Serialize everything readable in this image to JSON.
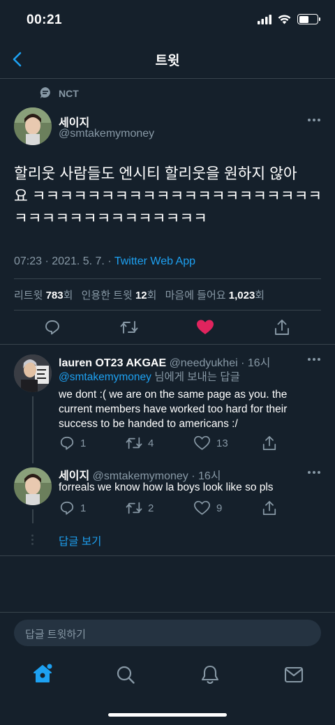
{
  "status_bar": {
    "time": "00:21"
  },
  "header": {
    "title": "트윗"
  },
  "social_context": {
    "label": "NCT"
  },
  "tweet": {
    "display_name": "세이지",
    "handle": "@smtakemymoney",
    "text_line1": "할리웃 사람들도 엔시티 할리웃을 원하지 않아",
    "text_line2": "요 ㅋㅋㅋㅋㅋㅋㅋㅋㅋㅋㅋㅋㅋㅋㅋㅋㅋㅋㅋㅋㅋ",
    "text_line3": "ㅋㅋㅋㅋㅋㅋㅋㅋㅋㅋㅋㅋㅋㅋ",
    "timestamp": "07:23 · 2021. 5. 7. · ",
    "source": "Twitter Web App",
    "stats": {
      "retweets_label": "리트윗",
      "retweets": "783",
      "retweets_unit": "회",
      "quotes_label": "인용한 트윗",
      "quotes": "12",
      "quotes_unit": "회",
      "likes_label": "마음에 들어요",
      "likes": "1,023",
      "likes_unit": "회"
    },
    "like_color": "#e0245e"
  },
  "replies": [
    {
      "display_name": "lauren OT23 AKGAE",
      "handle": "@needyukhei",
      "time": "· 16시",
      "reply_to_handle": "@smtakemymoney",
      "reply_to_suffix": " 님에게 보내는 답글",
      "text_line1": "we dont :( we are on the same page as you. the",
      "text_line2": "current members have worked too hard for their",
      "text_line3": "success to be handed to americans :/",
      "replies": "1",
      "retweets": "4",
      "likes": "13"
    },
    {
      "display_name": "세이지",
      "handle": "@smtakemymoney",
      "time": "· 16시",
      "text_line1": "forreals we know how la boys look like so pls",
      "replies": "1",
      "retweets": "2",
      "likes": "9"
    }
  ],
  "show_replies": {
    "label": "답글 보기"
  },
  "compose": {
    "placeholder": "답글 트윗하기"
  },
  "tabs": [
    {
      "icon": "home-icon"
    },
    {
      "icon": "search-icon"
    },
    {
      "icon": "bell-icon"
    },
    {
      "icon": "mail-icon"
    }
  ],
  "colors": {
    "background": "#15202b",
    "accent": "#1da1f2",
    "muted": "#8899a6",
    "divider": "#38444d"
  }
}
